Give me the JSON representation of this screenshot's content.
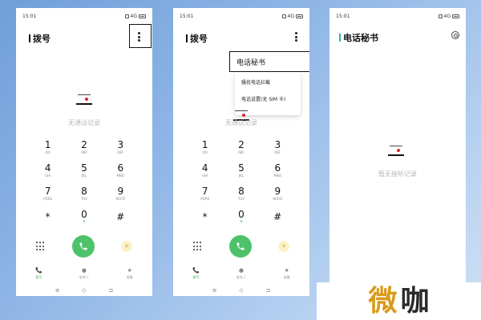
{
  "status": {
    "time": "15:01",
    "signal": "4G"
  },
  "screen1": {
    "title": "拨号",
    "empty_text": "无通话记录",
    "keys": [
      {
        "d": "1",
        "s": "QO"
      },
      {
        "d": "2",
        "s": "ABC"
      },
      {
        "d": "3",
        "s": "DEF"
      },
      {
        "d": "4",
        "s": "GHI"
      },
      {
        "d": "5",
        "s": "JKL"
      },
      {
        "d": "6",
        "s": "MNO"
      },
      {
        "d": "7",
        "s": "PQRS"
      },
      {
        "d": "8",
        "s": "TUV"
      },
      {
        "d": "9",
        "s": "WXYZ"
      },
      {
        "d": "*",
        "s": ""
      },
      {
        "d": "0",
        "s": "+"
      },
      {
        "d": "#",
        "s": ""
      }
    ],
    "nav": [
      {
        "icon": "phone-icon",
        "label": "拨号"
      },
      {
        "icon": "contacts-icon",
        "label": "联系人"
      },
      {
        "icon": "star-icon",
        "label": "收藏"
      }
    ]
  },
  "screen2": {
    "title": "拨号",
    "empty_text": "无通话记录",
    "menu_highlight": "电话秘书",
    "menu_items": [
      "骚扰电话拦截",
      "电话设置(无 SIM 卡)"
    ]
  },
  "screen3": {
    "title": "电话秘书",
    "empty_text": "暂无接听记录"
  },
  "watermark": {
    "char1": "微",
    "char2": "咖"
  },
  "colors": {
    "accent": "#4ec26a",
    "teal": "#2bb3a4",
    "dot": "#e0232b"
  }
}
